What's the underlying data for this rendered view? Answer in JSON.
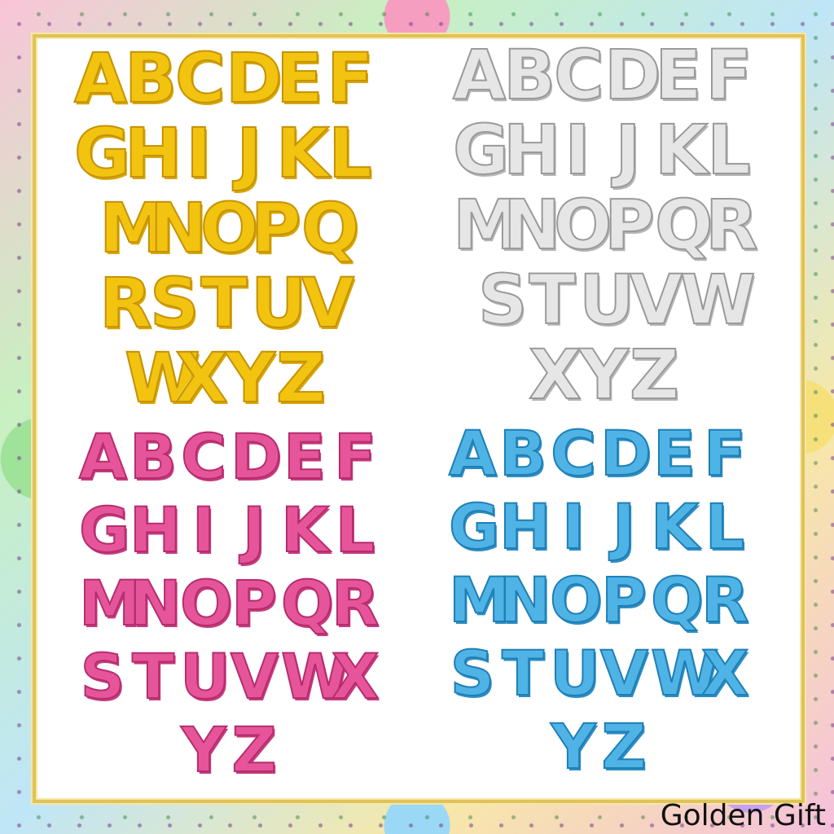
{
  "gold_rows": [
    [
      "A",
      "B",
      "C",
      "D",
      "E",
      "F"
    ],
    [
      "G",
      "H",
      "I",
      "J",
      "K",
      "L"
    ],
    [
      "M",
      "N",
      "O",
      "P",
      "Q"
    ],
    [
      "R",
      "S",
      "T",
      "U",
      "V"
    ],
    [
      "W",
      "X",
      "Y",
      "Z"
    ]
  ],
  "silver_rows": [
    [
      "A",
      "B",
      "C",
      "D",
      "E",
      "F"
    ],
    [
      "G",
      "H",
      "I",
      "J",
      "K",
      "L"
    ],
    [
      "M",
      "N",
      "O",
      "P",
      "Q",
      "R"
    ],
    [
      "S",
      "T",
      "U",
      "V",
      "W"
    ],
    [
      "X",
      "Y",
      "Z"
    ]
  ],
  "pink_rows": [
    [
      "A",
      "B",
      "C",
      "D",
      "E",
      "F"
    ],
    [
      "G",
      "H",
      "I",
      "J",
      "K",
      "L"
    ],
    [
      "M",
      "N",
      "O",
      "P",
      "Q",
      "R"
    ],
    [
      "S",
      "T",
      "U",
      "V",
      "W",
      "X"
    ],
    [
      "Y",
      "Z"
    ]
  ],
  "blue_rows": [
    [
      "A",
      "B",
      "C",
      "D",
      "E",
      "F"
    ],
    [
      "G",
      "H",
      "I",
      "J",
      "K",
      "L"
    ],
    [
      "M",
      "N",
      "O",
      "P",
      "Q",
      "R"
    ],
    [
      "S",
      "T",
      "U",
      "V",
      "W",
      "X"
    ],
    [
      "Y",
      "Z"
    ]
  ],
  "colors": {
    "gold": "#f2c30f",
    "silver": "#e6e6e6",
    "pink": "#e6559a",
    "blue": "#4fb3e6"
  },
  "watermark": "Golden Gift"
}
